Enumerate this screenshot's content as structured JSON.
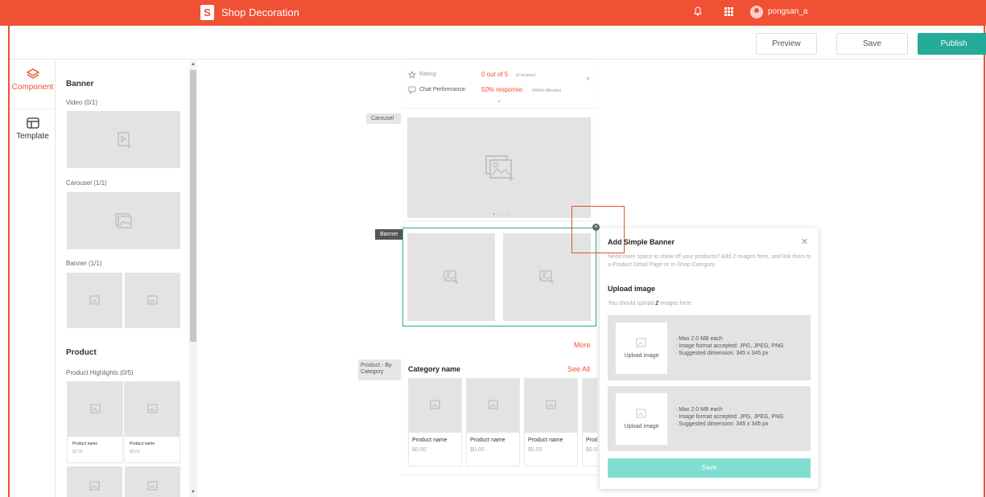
{
  "topbar": {
    "logo_letter": "S",
    "title": "Shop Decoration",
    "username": "pongsan_a"
  },
  "actions": {
    "preview": "Preview",
    "save": "Save",
    "publish": "Publish"
  },
  "nav": {
    "component": "Component",
    "template": "Template"
  },
  "panel": {
    "banner_heading": "Banner",
    "video_label": "Video (0/1)",
    "carousel_label": "Carousel (1/1)",
    "banner_label": "Banner (1/1)",
    "product_heading": "Product",
    "highlights_label": "Product Highlights (0/5)",
    "product_name": "Product name",
    "product_price": "$0.00"
  },
  "shop_info": {
    "rating_label": "Rating:",
    "rating_value": "0 out of 5",
    "rating_reviews": "(0 reviews)",
    "chat_label": "Chat Performance:",
    "chat_value": "50% response",
    "chat_note": "(Within Minutes)"
  },
  "sections": {
    "carousel_tag": "Carousel",
    "banner_tag": "Banner",
    "more_link": "More",
    "category_tag": "Product - By Category",
    "category_name": "Category name",
    "see_all": "See All",
    "product_name": "Product name",
    "product_price": "$0.00"
  },
  "modal": {
    "title": "Add Simple Banner",
    "description": "Need more space to show off your products? Add 2 images here, and link them to a Product Detail Page or In-Shop Category.",
    "upload_title": "Upload image",
    "upload_note_prefix": "You should upload ",
    "upload_note_count": "2",
    "upload_note_suffix": " images here.",
    "upload_button": "Upload image",
    "spec_size": "· Max 2.0 MB each",
    "spec_format": "· Image format accepted: JPG, JPEG, PNG",
    "spec_dimension": "· Suggested dimension: 345 x 345 px",
    "save": "Save"
  },
  "colors": {
    "brand": "#f05033",
    "accent": "#26aa99",
    "accent_light": "#7fded1"
  }
}
